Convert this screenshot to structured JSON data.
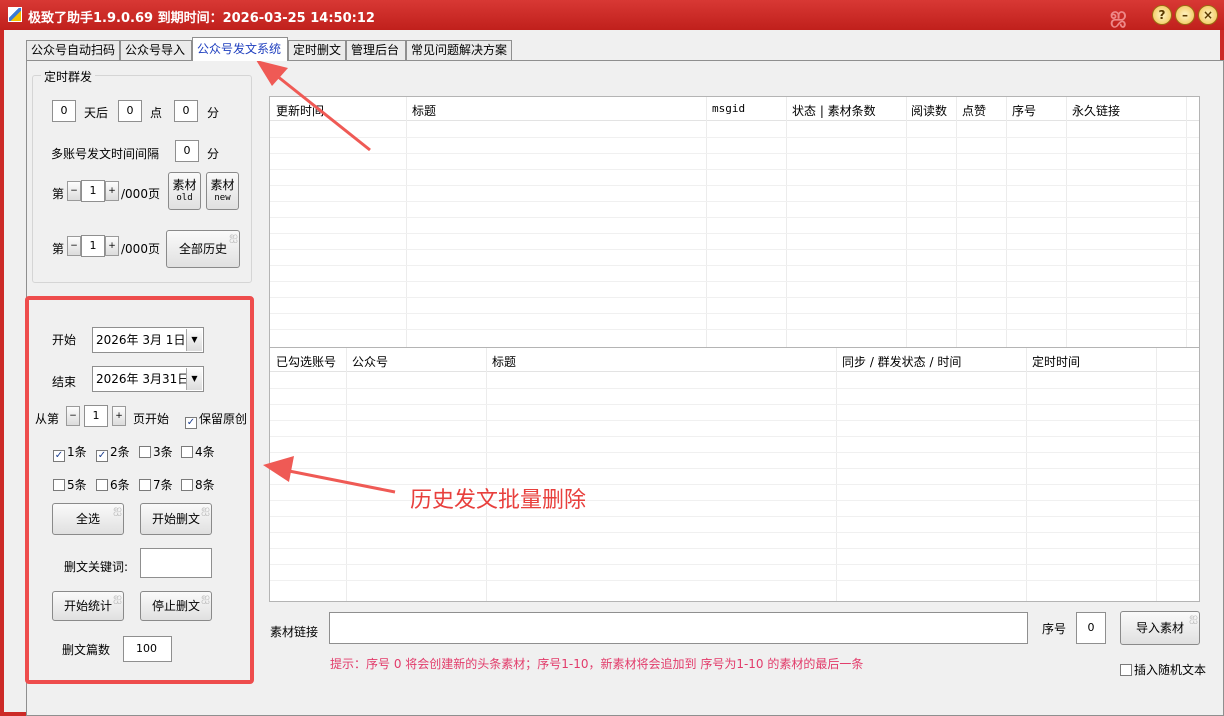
{
  "window": {
    "title": "极致了助手1.9.0.69 到期时间：2026-03-25 14:50:12",
    "deco": "ஜ",
    "buttons": {
      "help": "?",
      "minimize": "–",
      "close": "×"
    }
  },
  "tabs": [
    {
      "label": "公众号自动扫码"
    },
    {
      "label": "公众号导入"
    },
    {
      "label": "公众号发文系统",
      "active": true
    },
    {
      "label": "定时删文"
    },
    {
      "label": "管理后台"
    },
    {
      "label": "常见问题解决方案"
    }
  ],
  "scheduled": {
    "group_title": "定时群发",
    "days_value": "0",
    "days_label": "天后",
    "hour_value": "0",
    "hour_label": "点",
    "minute_value": "0",
    "minute_label": "分",
    "interval_label": "多账号发文时间间隔",
    "interval_value": "0",
    "interval_unit": "分",
    "page1_prefix": "第",
    "page1_value": "1",
    "page1_suffix": "/000页",
    "page2_prefix": "第",
    "page2_value": "1",
    "page2_suffix": "/000页",
    "btn_old_line1": "素材",
    "btn_old_line2": "old",
    "btn_new_line1": "素材",
    "btn_new_line2": "new",
    "btn_all_history": "全部历史"
  },
  "history_delete": {
    "start_label": "开始",
    "start_date": "2026年 3月 1日",
    "end_label": "结束",
    "end_date": "2026年 3月31日",
    "from_prefix": "从第",
    "from_value": "1",
    "from_suffix": "页开始",
    "keep_original_label": "保留原创",
    "keep_original_checked": true,
    "items": [
      {
        "label": "1条",
        "checked": true
      },
      {
        "label": "2条",
        "checked": true
      },
      {
        "label": "3条",
        "checked": false
      },
      {
        "label": "4条",
        "checked": false
      },
      {
        "label": "5条",
        "checked": false
      },
      {
        "label": "6条",
        "checked": false
      },
      {
        "label": "7条",
        "checked": false
      },
      {
        "label": "8条",
        "checked": false
      }
    ],
    "select_all": "全选",
    "start_delete": "开始删文",
    "keyword_label": "删文关键词:",
    "keyword_value": "",
    "start_stats": "开始统计",
    "stop_delete": "停止删文",
    "count_label": "删文篇数",
    "count_value": "100"
  },
  "grid_top": {
    "columns": [
      "更新时间",
      "标题",
      "msgid",
      "状态 | 素材条数",
      "阅读数",
      "点赞",
      "序号",
      "永久链接"
    ]
  },
  "grid_bottom": {
    "columns": [
      "已勾选账号",
      "公众号",
      "标题",
      "同步 / 群发状态 / 时间",
      "定时时间"
    ]
  },
  "bottom_bar": {
    "link_label": "素材链接",
    "link_value": "",
    "seq_label": "序号",
    "seq_value": "0",
    "import_button": "导入素材",
    "hint": "提示：序号 0 将会创建新的头条素材；序号1-10，新素材将会追加到 序号为1-10 的素材的最后一条",
    "random_text_label": "插入随机文本",
    "random_text_checked": false
  },
  "annotation": {
    "text": "历史发文批量删除",
    "color": "#e8403d"
  },
  "colors": {
    "frame": "#cc2a27",
    "active_tab_text": "#1f3fbf",
    "hint": "#e23b6a"
  },
  "icons": {
    "curl": "ஐ",
    "spin_minus": "−",
    "spin_plus": "+",
    "dropdown": "▼",
    "check": "✓"
  }
}
